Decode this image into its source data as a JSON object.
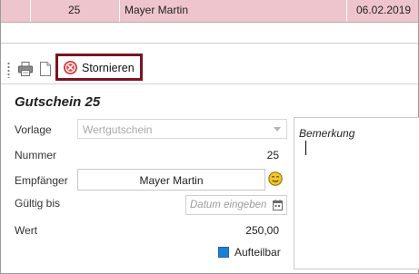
{
  "grid": {
    "row": {
      "number": "25",
      "name": "Mayer Martin",
      "date": "06.02.2019"
    }
  },
  "toolbar": {
    "print_icon": "printer-icon",
    "doc_icon": "document-icon",
    "cancel_icon": "cancel-circle-icon",
    "cancel_label": "Stornieren"
  },
  "form": {
    "title": "Gutschein 25",
    "template_label": "Vorlage",
    "template_value": "Wertgutschein",
    "number_label": "Nummer",
    "number_value": "25",
    "recipient_label": "Empfänger",
    "recipient_value": "Mayer Martin",
    "recipient_icon": "smiley-icon",
    "valid_label": "Gültig bis",
    "valid_placeholder": "Datum eingeben",
    "calendar_icon": "calendar-icon",
    "value_label": "Wert",
    "value_value": "250,00",
    "split_label": "Aufteilbar",
    "split_checked": true
  },
  "remarks": {
    "placeholder": "Bemerkung"
  },
  "colors": {
    "selected_row": "#eec5cd",
    "highlight_border": "#7b1420",
    "checkbox": "#1d7fd1"
  }
}
